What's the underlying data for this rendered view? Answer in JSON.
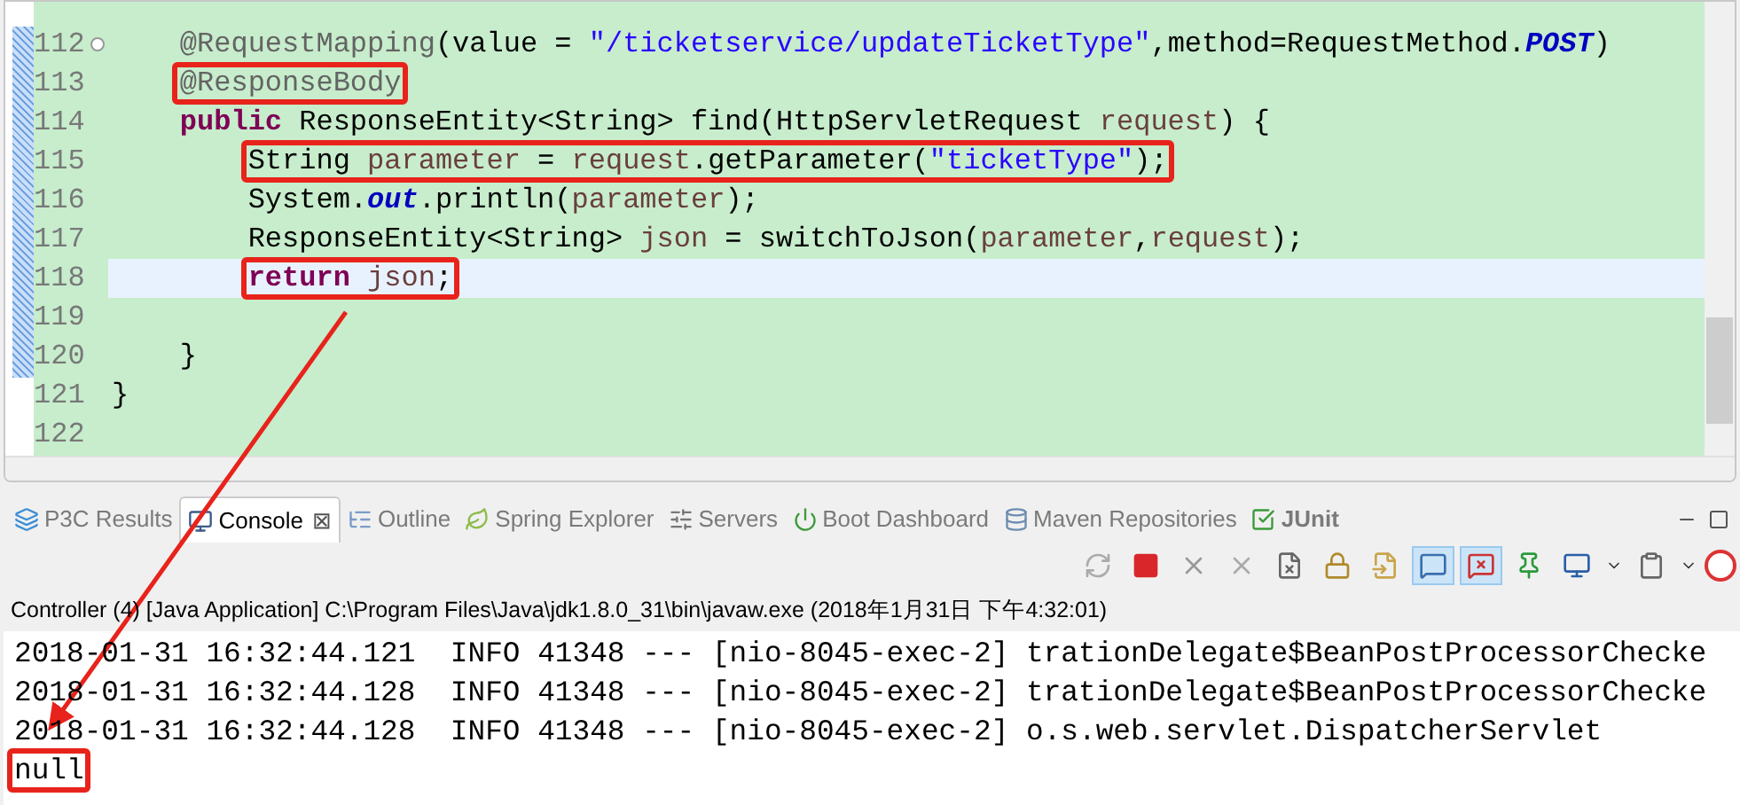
{
  "editor": {
    "lines": [
      {
        "number": "112",
        "current": false,
        "boxed": false,
        "folding": true,
        "segments": [
          {
            "kind": "annotation",
            "text": "    @RequestMapping"
          },
          {
            "kind": "plain",
            "text": "(value = "
          },
          {
            "kind": "string",
            "text": "\"/ticketservice/updateTicketType\""
          },
          {
            "kind": "plain",
            "text": ",method=RequestMethod."
          },
          {
            "kind": "constant",
            "text": "POST"
          },
          {
            "kind": "plain",
            "text": ")"
          }
        ]
      },
      {
        "number": "113",
        "current": false,
        "boxed": true,
        "segments": [
          {
            "kind": "annotation",
            "text": "    @ResponseBody"
          }
        ]
      },
      {
        "number": "114",
        "current": false,
        "boxed": false,
        "segments": [
          {
            "kind": "keyword",
            "text": "    public"
          },
          {
            "kind": "plain",
            "text": " ResponseEntity<String> find(HttpServletRequest "
          },
          {
            "kind": "variable",
            "text": "request"
          },
          {
            "kind": "plain",
            "text": ") {"
          }
        ]
      },
      {
        "number": "115",
        "current": false,
        "boxed": true,
        "segments": [
          {
            "kind": "plain",
            "text": "        String "
          },
          {
            "kind": "variable",
            "text": "parameter"
          },
          {
            "kind": "plain",
            "text": " = "
          },
          {
            "kind": "variable",
            "text": "request"
          },
          {
            "kind": "plain",
            "text": ".getParameter("
          },
          {
            "kind": "string",
            "text": "\"ticketType\""
          },
          {
            "kind": "plain",
            "text": ");"
          }
        ]
      },
      {
        "number": "116",
        "current": false,
        "boxed": false,
        "segments": [
          {
            "kind": "plain",
            "text": "        System."
          },
          {
            "kind": "static",
            "text": "out"
          },
          {
            "kind": "plain",
            "text": ".println("
          },
          {
            "kind": "variable",
            "text": "parameter"
          },
          {
            "kind": "plain",
            "text": ");"
          }
        ]
      },
      {
        "number": "117",
        "current": false,
        "boxed": false,
        "segments": [
          {
            "kind": "plain",
            "text": "        ResponseEntity<String> "
          },
          {
            "kind": "variable",
            "text": "json"
          },
          {
            "kind": "plain",
            "text": " = switchToJson("
          },
          {
            "kind": "variable",
            "text": "parameter"
          },
          {
            "kind": "plain",
            "text": ","
          },
          {
            "kind": "variable",
            "text": "request"
          },
          {
            "kind": "plain",
            "text": ");"
          }
        ]
      },
      {
        "number": "118",
        "current": true,
        "boxed": true,
        "segments": [
          {
            "kind": "keyword",
            "text": "        return"
          },
          {
            "kind": "variable",
            "text": " json"
          },
          {
            "kind": "plain",
            "text": ";"
          }
        ]
      },
      {
        "number": "119",
        "current": false
      },
      {
        "number": "120",
        "current": false,
        "boxed": false,
        "segments": [
          {
            "kind": "plain",
            "text": "    }"
          }
        ]
      },
      {
        "number": "121",
        "current": false,
        "boxed": false,
        "segments": [
          {
            "kind": "plain",
            "text": "}"
          }
        ]
      },
      {
        "number": "122",
        "current": false
      }
    ]
  },
  "views": {
    "tabs": [
      {
        "label": "P3C Results",
        "selected": false
      },
      {
        "label": "Console",
        "selected": true,
        "close": "⊠"
      },
      {
        "label": "Outline",
        "selected": false
      },
      {
        "label": "Spring Explorer",
        "selected": false
      },
      {
        "label": "Servers",
        "selected": false
      },
      {
        "label": "Boot Dashboard",
        "selected": false
      },
      {
        "label": "Maven Repositories",
        "selected": false
      },
      {
        "label": "JUnit",
        "selected": false
      }
    ]
  },
  "toolbar": [
    {
      "pressed": false
    },
    {
      "pressed": false
    },
    {
      "pressed": false
    },
    {
      "pressed": false
    },
    {
      "pressed": false
    },
    {
      "pressed": false
    },
    {
      "pressed": false
    },
    {
      "pressed": true
    },
    {
      "pressed": true
    },
    {
      "pressed": false
    },
    {
      "pressed": false
    },
    {
      "pressed": false
    },
    {
      "pressed": false
    },
    {
      "pressed": false
    }
  ],
  "console": {
    "header": "Controller (4) [Java Application] C:\\Program Files\\Java\\jdk1.8.0_31\\bin\\javaw.exe (2018年1月31日 下午4:32:01)",
    "lines": [
      {
        "text": "2018-01-31 16:32:44.121  INFO 41348 --- [nio-8045-exec-2] trationDelegate$BeanPostProcessorChecke",
        "boxed": false
      },
      {
        "text": "2018-01-31 16:32:44.128  INFO 41348 --- [nio-8045-exec-2] trationDelegate$BeanPostProcessorChecke",
        "boxed": false
      },
      {
        "text": "2018-01-31 16:32:44.128  INFO 41348 --- [nio-8045-exec-2] o.s.web.servlet.DispatcherServlet",
        "boxed": false
      },
      {
        "text": "null",
        "boxed": true
      }
    ]
  }
}
